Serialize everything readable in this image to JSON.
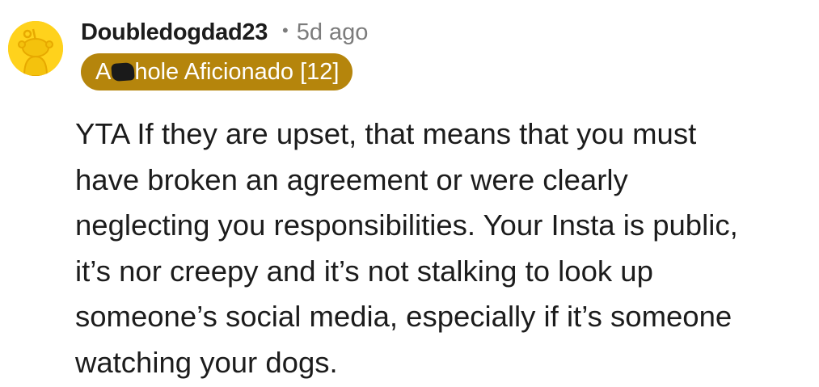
{
  "comment": {
    "author": "Doubledogdad23",
    "separator": "•",
    "timestamp": "5d ago",
    "flair": {
      "prefix": "A",
      "suffix": "hole Aficionado [12]",
      "background_color": "#b5850c"
    },
    "body": "YTA If they are upset, that means that you must\nhave broken an agreement or were clearly\nneglecting you responsibilities. Your Insta is public,\nit’s nor creepy and it’s not stalking to look up\nsomeone’s social media, especially if it’s someone\nwatching your dogs."
  },
  "avatar": {
    "icon": "reddit-snoo-avatar-icon",
    "background_color": "#ffd21c"
  }
}
